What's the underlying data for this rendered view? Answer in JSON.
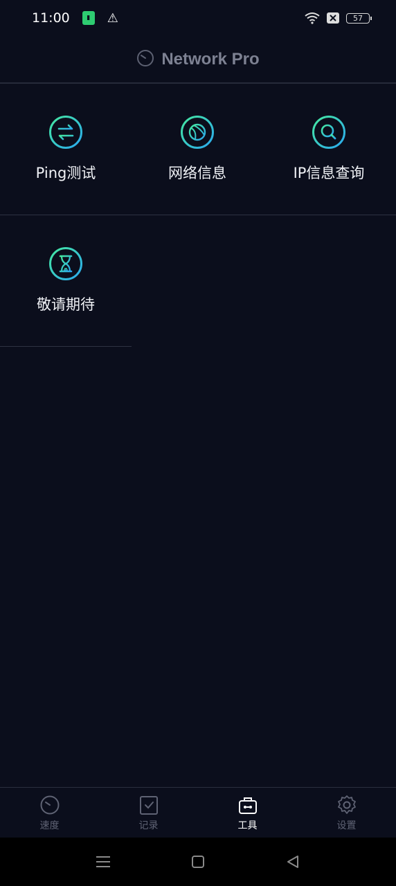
{
  "status": {
    "time": "11:00",
    "battery": "57"
  },
  "header": {
    "title": "Network Pro"
  },
  "tools": [
    {
      "label": "Ping测试",
      "icon": "transfer-arrows-icon"
    },
    {
      "label": "网络信息",
      "icon": "globe-icon"
    },
    {
      "label": "IP信息查询",
      "icon": "search-icon"
    },
    {
      "label": "敬请期待",
      "icon": "hourglass-icon"
    }
  ],
  "tabs": [
    {
      "label": "速度",
      "icon": "speedometer-icon",
      "active": false
    },
    {
      "label": "记录",
      "icon": "checklist-icon",
      "active": false
    },
    {
      "label": "工具",
      "icon": "toolbox-icon",
      "active": true
    },
    {
      "label": "设置",
      "icon": "gear-icon",
      "active": false
    }
  ],
  "colors": {
    "background": "#0b0e1c",
    "accent_start": "#3fe0a6",
    "accent_end": "#2fb4e8",
    "inactive": "#5f6374"
  }
}
